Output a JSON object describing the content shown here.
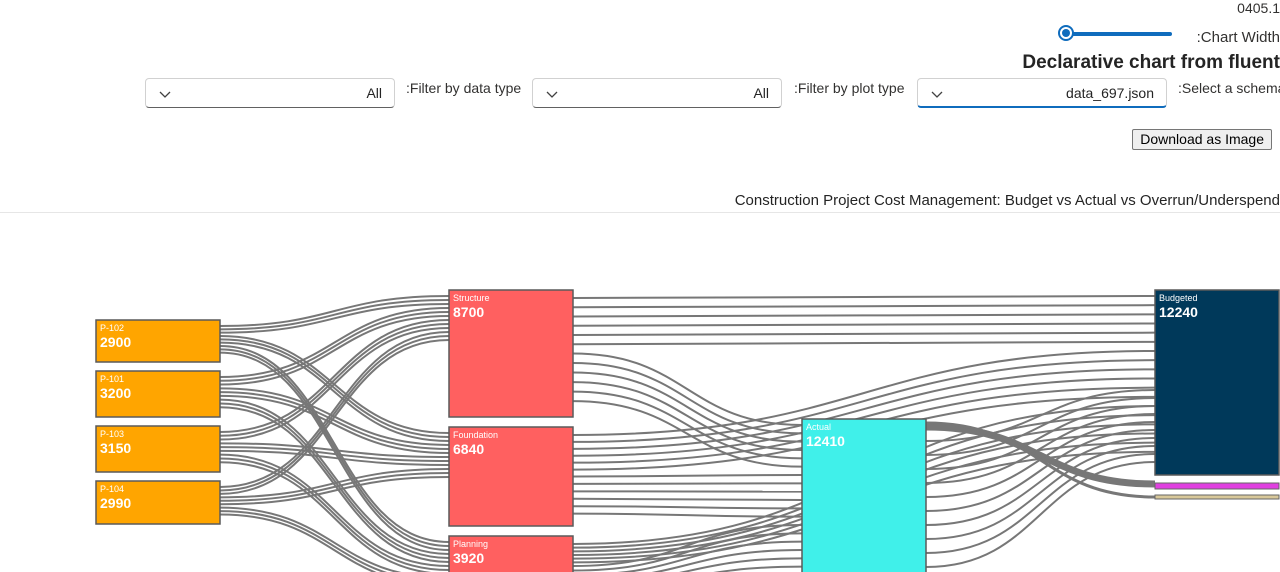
{
  "header": {
    "version": "0405.1",
    "chart_width_label": ":Chart Width",
    "title": "Declarative chart from fluent"
  },
  "filters": {
    "data_type": {
      "label": ":Filter by data type",
      "value": "All"
    },
    "plot_type": {
      "label": ":Filter by plot type",
      "value": "All"
    },
    "schema": {
      "label": ":Select a schema",
      "value": "data_697.json"
    }
  },
  "download_label": "Download as Image",
  "chart_data": {
    "type": "sankey",
    "title": "Construction Project Cost Management: Budget vs Actual vs Overrun/Underspend",
    "nodes": [
      {
        "name": "P-102",
        "value": 2900,
        "color": "#ffa500"
      },
      {
        "name": "P-101",
        "value": 3200,
        "color": "#ffa500"
      },
      {
        "name": "P-103",
        "value": 3150,
        "color": "#ffa500"
      },
      {
        "name": "P-104",
        "value": 2990,
        "color": "#ffa500"
      },
      {
        "name": "Structure",
        "value": 8700,
        "color": "#ff6060"
      },
      {
        "name": "Foundation",
        "value": 6840,
        "color": "#ff6060"
      },
      {
        "name": "Planning",
        "value": 3920,
        "color": "#ff6060"
      },
      {
        "name": "Actual",
        "value": 12410,
        "color": "#40f0ea"
      },
      {
        "name": "Budgeted",
        "value": 12240,
        "color": "#00395a"
      }
    ],
    "link_color": "#777777"
  }
}
